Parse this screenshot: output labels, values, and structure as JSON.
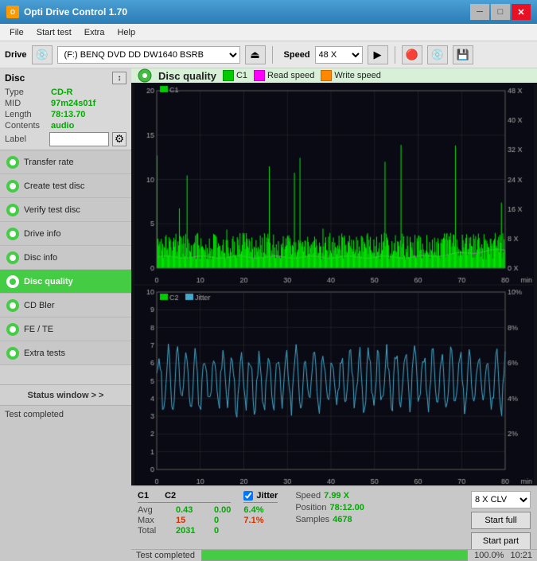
{
  "titleBar": {
    "title": "Opti Drive Control 1.70",
    "icon": "ODC"
  },
  "menu": {
    "items": [
      "File",
      "Start test",
      "Extra",
      "Help"
    ]
  },
  "drive": {
    "label": "Drive",
    "value": "(F:)  BENQ DVD DD DW1640 BSRB",
    "speedLabel": "Speed",
    "speedValue": "48 X"
  },
  "disc": {
    "panelTitle": "Disc",
    "fields": [
      {
        "label": "Type",
        "value": "CD-R"
      },
      {
        "label": "MID",
        "value": "97m24s01f"
      },
      {
        "label": "Length",
        "value": "78:13.70"
      },
      {
        "label": "Contents",
        "value": "audio"
      }
    ],
    "labelField": "Label"
  },
  "nav": {
    "items": [
      {
        "id": "transfer-rate",
        "label": "Transfer rate"
      },
      {
        "id": "create-test-disc",
        "label": "Create test disc"
      },
      {
        "id": "verify-test-disc",
        "label": "Verify test disc"
      },
      {
        "id": "drive-info",
        "label": "Drive info"
      },
      {
        "id": "disc-info",
        "label": "Disc info"
      },
      {
        "id": "disc-quality",
        "label": "Disc quality",
        "active": true
      },
      {
        "id": "cd-bler",
        "label": "CD Bler"
      },
      {
        "id": "fe-te",
        "label": "FE / TE"
      },
      {
        "id": "extra-tests",
        "label": "Extra tests"
      }
    ]
  },
  "statusWindow": {
    "label": "Status window > >"
  },
  "chartMain": {
    "title": "Disc quality",
    "legends": [
      {
        "label": "C1",
        "color": "#00ff00"
      },
      {
        "label": "Read speed",
        "color": "#ff00ff"
      },
      {
        "label": "Write speed",
        "color": "#ff6600"
      }
    ],
    "xMax": 80,
    "yMax": 20,
    "yMaxRight": 48
  },
  "chartJitter": {
    "legends": [
      {
        "label": "C2",
        "color": "#00ff00"
      },
      {
        "label": "Jitter",
        "color": "#00aaff"
      }
    ],
    "xMax": 80,
    "yMax": 10,
    "yMaxRight": 10
  },
  "stats": {
    "c1Label": "C1",
    "c2Label": "C2",
    "jitterLabel": "Jitter",
    "rows": [
      {
        "label": "Avg",
        "c1": "0.43",
        "c2": "0.00",
        "jitter": "6.4%"
      },
      {
        "label": "Max",
        "c1": "15",
        "c2": "0",
        "jitter": "7.1%"
      },
      {
        "label": "Total",
        "c1": "2031",
        "c2": "0",
        "jitter": ""
      }
    ],
    "speed": {
      "label": "Speed",
      "value": "7.99 X",
      "positionLabel": "Position",
      "positionValue": "78:12.00",
      "samplesLabel": "Samples",
      "samplesValue": "4678"
    },
    "clvOption": "8 X CLV",
    "buttons": [
      "Start full",
      "Start part"
    ]
  },
  "testBar": {
    "text": "Test completed",
    "progress": 100,
    "time": "10:21"
  }
}
